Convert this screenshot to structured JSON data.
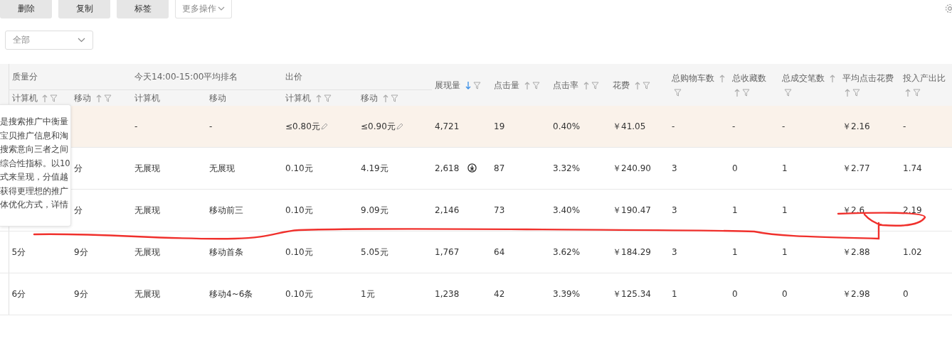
{
  "toolbar": {
    "buttons": [
      {
        "label": "删除",
        "kind": "action"
      },
      {
        "label": "复制",
        "kind": "action"
      },
      {
        "label": "标签",
        "kind": "action"
      },
      {
        "label": "更多操作",
        "kind": "dropdown"
      }
    ]
  },
  "filter": {
    "value": "全部"
  },
  "table": {
    "header": [
      {
        "kind": "group",
        "label": "质量分",
        "columns": [
          {
            "label": "计算机",
            "sortable": true,
            "sorted": false,
            "filterable": true
          },
          {
            "label": "移动",
            "sortable": true,
            "sorted": false,
            "filterable": true
          }
        ]
      },
      {
        "kind": "group",
        "label": "今天14:00-15:00平均排名",
        "columns": [
          {
            "label": "计算机",
            "sortable": false,
            "sorted": false,
            "filterable": false
          },
          {
            "label": "移动",
            "sortable": false,
            "sorted": false,
            "filterable": false
          }
        ]
      },
      {
        "kind": "group",
        "label": "出价",
        "columns": [
          {
            "label": "计算机",
            "sortable": true,
            "sorted": false,
            "filterable": true
          },
          {
            "label": "移动",
            "sortable": true,
            "sorted": false,
            "filterable": true
          }
        ]
      },
      {
        "kind": "single",
        "label": "展现量",
        "sortable": true,
        "sorted": true,
        "filterable": true
      },
      {
        "kind": "single",
        "label": "点击量",
        "sortable": true,
        "sorted": false,
        "filterable": true
      },
      {
        "kind": "single",
        "label": "点击率",
        "sortable": true,
        "sorted": false,
        "filterable": true
      },
      {
        "kind": "single",
        "label": "花费",
        "sortable": true,
        "sorted": false,
        "filterable": true
      },
      {
        "kind": "single",
        "label": "总购物车数",
        "sortable": true,
        "sorted": false,
        "filterable": true
      },
      {
        "kind": "single",
        "label": "总收藏数",
        "sortable": true,
        "sorted": false,
        "filterable": true
      },
      {
        "kind": "single",
        "label": "总成交笔数",
        "sortable": true,
        "sorted": false,
        "filterable": true
      },
      {
        "kind": "single",
        "label": "平均点击花费",
        "sortable": true,
        "sorted": false,
        "filterable": true
      },
      {
        "kind": "single",
        "label": "投入产出比",
        "sortable": true,
        "sorted": false,
        "filterable": true
      }
    ],
    "rows": [
      {
        "kind": "summary",
        "editable_bids": true,
        "download_marker": false,
        "cells": [
          null,
          null,
          "-",
          "-",
          "≤0.80元",
          "≤0.90元",
          "4,721",
          "19",
          "0.40%",
          "￥41.05",
          "-",
          "-",
          "-",
          "￥2.16",
          "-"
        ]
      },
      {
        "kind": "normal",
        "editable_bids": false,
        "download_marker": true,
        "cells": [
          null,
          "分",
          "无展现",
          "无展现",
          "0.10元",
          "4.19元",
          "2,618",
          "87",
          "3.32%",
          "￥240.90",
          "3",
          "0",
          "1",
          "￥2.77",
          "1.74"
        ]
      },
      {
        "kind": "normal",
        "editable_bids": false,
        "download_marker": false,
        "cells": [
          null,
          "分",
          "无展现",
          "移动前三",
          "0.10元",
          "9.09元",
          "2,146",
          "73",
          "3.40%",
          "￥190.47",
          "3",
          "1",
          "1",
          "￥2.6",
          "2.19"
        ]
      },
      {
        "kind": "normal",
        "editable_bids": false,
        "download_marker": false,
        "cells": [
          "5分",
          "9分",
          "无展现",
          "移动首条",
          "0.10元",
          "5.05元",
          "1,767",
          "64",
          "3.62%",
          "￥184.29",
          "3",
          "1",
          "1",
          "￥2.88",
          "1.02"
        ]
      },
      {
        "kind": "normal",
        "editable_bids": false,
        "download_marker": false,
        "cells": [
          "6分",
          "9分",
          "无展现",
          "移动4~6条",
          "0.10元",
          "1元",
          "1,238",
          "42",
          "3.39%",
          "￥125.34",
          "1",
          "0",
          "0",
          "￥2.98",
          "0"
        ]
      }
    ]
  },
  "tooltip": {
    "lines": [
      "是搜索推广中衡量",
      "宝贝推广信息和淘",
      "搜索意向三者之间",
      "综合性指标。以10",
      "式来呈现，分值越",
      "获得更理想的推广",
      "体优化方式，详情"
    ]
  }
}
